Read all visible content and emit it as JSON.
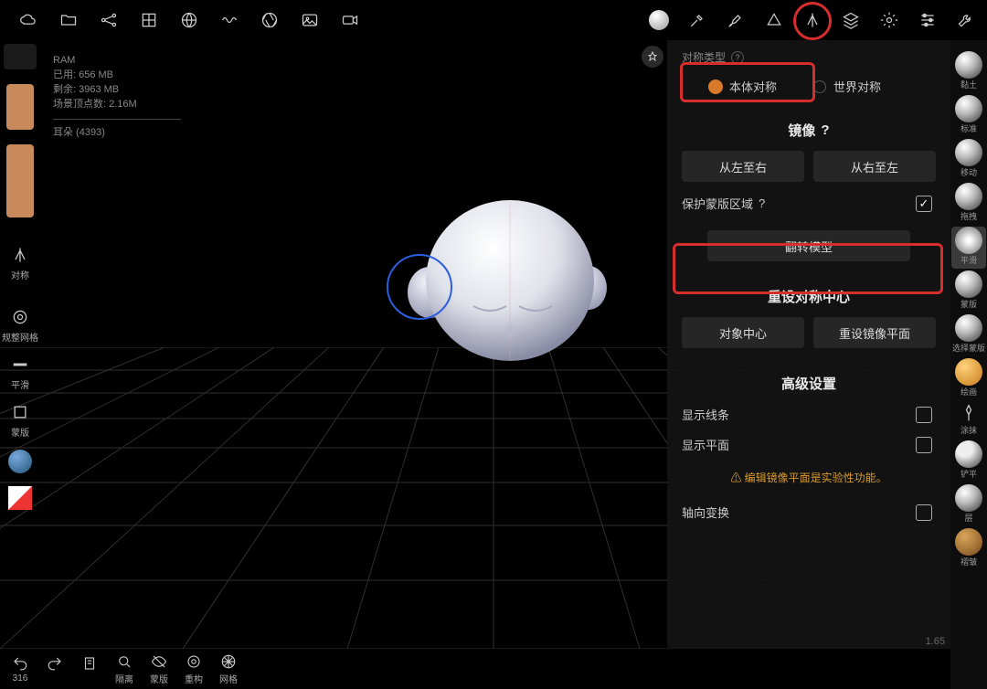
{
  "stats": {
    "ram_label": "RAM",
    "used": "已用: 656 MB",
    "free": "剩余: 3963 MB",
    "verts": "场景顶点数: 2.16M",
    "selection": "耳朵 (4393)"
  },
  "topbar_icons": [
    "cloud",
    "folder",
    "network",
    "grid",
    "globe",
    "wave",
    "aperture",
    "image",
    "video"
  ],
  "topbar_right_icons": [
    "brushball",
    "eyedropper",
    "paintbrush",
    "shape",
    "symmetry",
    "layers",
    "gear",
    "sliders",
    "wrench"
  ],
  "left": {
    "swatch1": "#c88a5a",
    "swatch2": "#c88a5a",
    "sym_label": "对称",
    "adjust_label": "规整网格",
    "smooth_label": "平滑",
    "mask_label": "蒙版"
  },
  "brushes": [
    {
      "label": "黏土"
    },
    {
      "label": "标准"
    },
    {
      "label": "移动"
    },
    {
      "label": "拖拽"
    },
    {
      "label": "平滑",
      "active": true
    },
    {
      "label": "蒙版"
    },
    {
      "label": "选择蒙版"
    },
    {
      "label": "绘画"
    },
    {
      "label": "涂抹"
    },
    {
      "label": "铲平"
    },
    {
      "label": "层"
    },
    {
      "label": "褶皱"
    }
  ],
  "panel": {
    "type_label": "对称类型",
    "local": "本体对称",
    "world": "世界对称",
    "mirror_heading": "镜像",
    "ltr": "从左至右",
    "rtl": "从右至左",
    "protect_mask": "保护蒙版区域",
    "flip": "翻转模型",
    "reset_heading": "重设对称中心",
    "obj_center": "对象中心",
    "reset_plane": "重设镜像平面",
    "adv_heading": "高级设置",
    "show_lines": "显示线条",
    "show_plane": "显示平面",
    "warn": "⚠ 编辑镜像平面是实验性功能。",
    "axis_swap": "轴向变换"
  },
  "bottom": {
    "undo_count": "316",
    "isolate": "隔离",
    "mask": "蒙版",
    "rebuild": "重构",
    "mesh": "网格"
  },
  "corner_num": "1.65"
}
